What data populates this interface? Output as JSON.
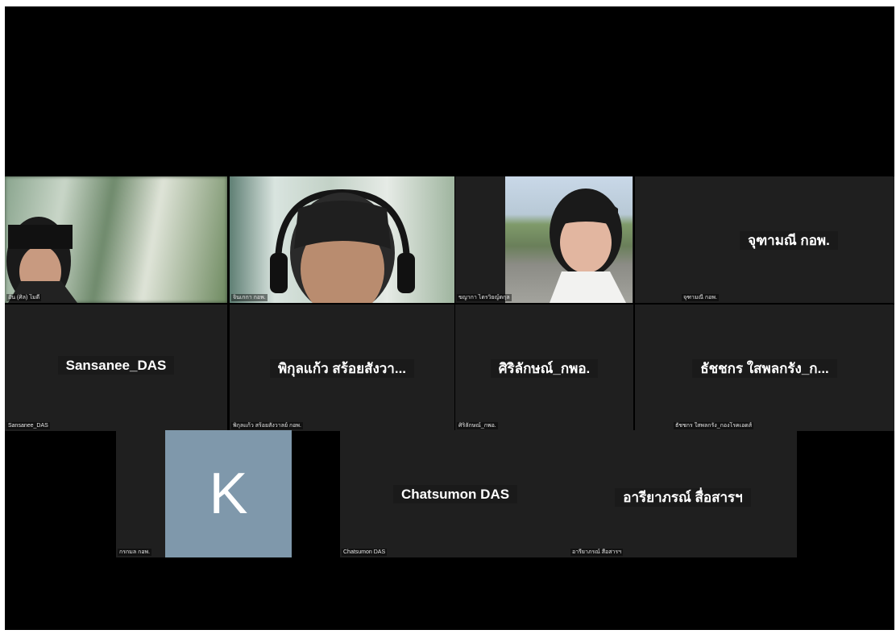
{
  "participants": {
    "p1": {
      "tag": "อัน (ศิล) โมดี"
    },
    "p2": {
      "tag": "จินเกกา กอพ."
    },
    "p3": {
      "tag": "ขญากา ไตรวิยญ์ตกุล"
    },
    "p4": {
      "name": "จุฑามณี กอพ.",
      "tag": "จุฑามณี กอพ."
    },
    "p5": {
      "name": "Sansanee_DAS",
      "tag": "Sansanee_DAS"
    },
    "p6": {
      "name": "พิกุลแก้ว สร้อยสังวา...",
      "tag": "พิกุลแก้ว สร้อยสังวาลย์ กอพ."
    },
    "p7": {
      "name": "ศิริลักษณ์_กพอ.",
      "tag": "ศิริลักษณ์_กพอ."
    },
    "p8": {
      "name": "ธัชชกร ใสพลกรัง_ก...",
      "tag": "ธัชชกร ใสพลกรัง_กองโรคเอดส์"
    },
    "p9": {
      "avatar_letter": "K",
      "tag": "กรกมล กอพ.",
      "avatar_color": "#7f98ab"
    },
    "p10": {
      "name": "Chatsumon DAS",
      "tag": "Chatsumon DAS"
    },
    "p11": {
      "name": "อารียาภรณ์ สื่อสารฯ",
      "tag": "อารียาภรณ์ สื่อสารฯ"
    }
  },
  "colors": {
    "stage": "#000000",
    "tile": "#1f1f1f",
    "avatar": "#7f98ab"
  }
}
